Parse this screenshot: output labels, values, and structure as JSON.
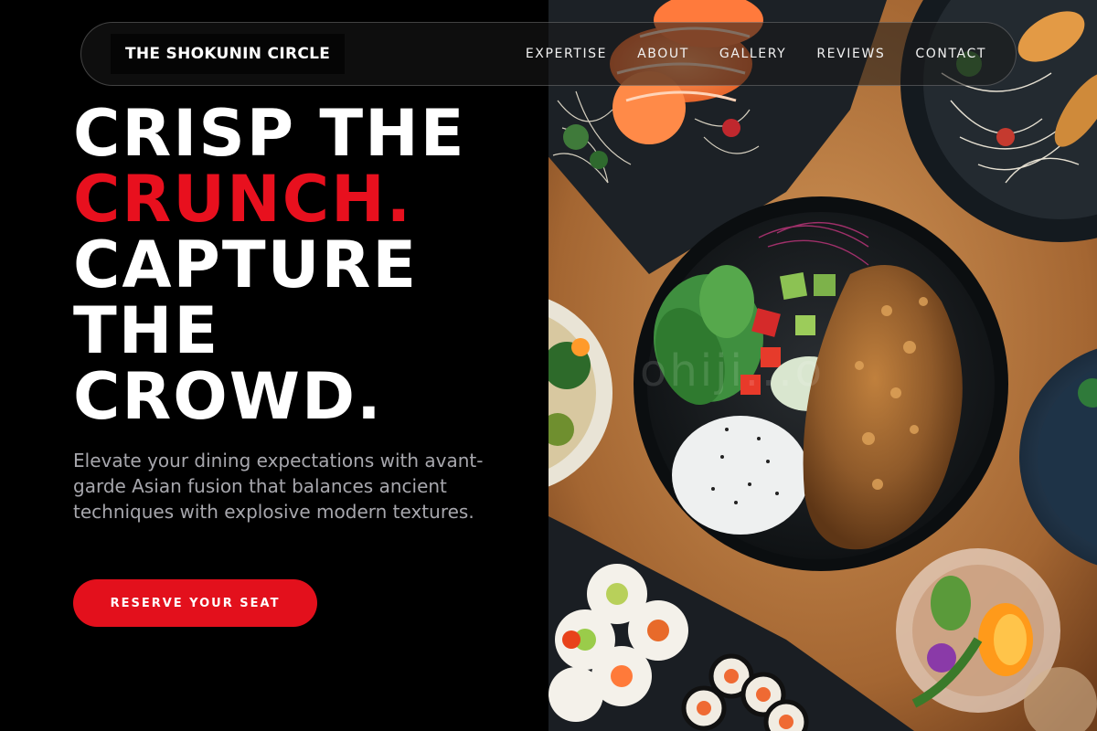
{
  "brand": {
    "name": "THE SHOKUNIN CIRCLE"
  },
  "nav": {
    "items": [
      {
        "label": "EXPERTISE"
      },
      {
        "label": "ABOUT"
      },
      {
        "label": "GALLERY"
      },
      {
        "label": "REVIEWS"
      },
      {
        "label": "CONTACT"
      }
    ]
  },
  "hero": {
    "headline": {
      "line1": "CRISP THE",
      "line2": "CRUNCH.",
      "line3": "CAPTURE",
      "line4": "THE",
      "line5": "CROWD."
    },
    "subtitle": "Elevate your dining expectations with avant-garde Asian fusion that balances ancient techniques with explosive modern textures.",
    "cta_label": "RESERVE YOUR SEAT"
  },
  "image": {
    "watermark": "ohiji...o"
  },
  "colors": {
    "accent": "#e3101c",
    "background": "#000000",
    "subtitle_text": "#a7a7ad"
  },
  "icons": []
}
